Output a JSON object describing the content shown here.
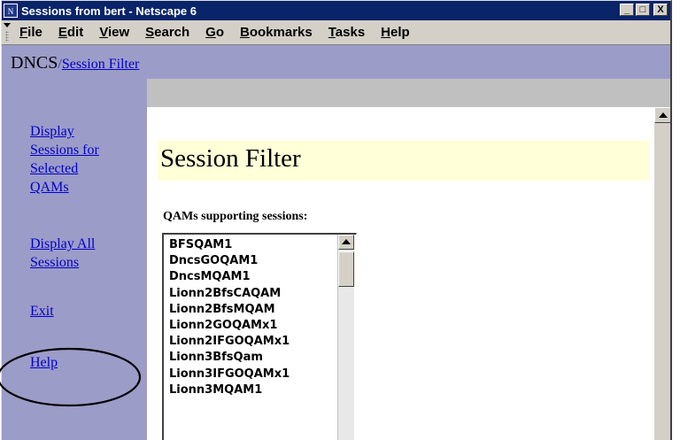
{
  "window": {
    "title": "Sessions from bert - Netscape 6",
    "icon": "N"
  },
  "window_buttons": {
    "minimize": "_",
    "maximize": "□",
    "close": "X"
  },
  "menu": [
    {
      "label": "File",
      "mnemonic": "F",
      "rest": "ile"
    },
    {
      "label": "Edit",
      "mnemonic": "E",
      "rest": "dit"
    },
    {
      "label": "View",
      "mnemonic": "V",
      "rest": "iew"
    },
    {
      "label": "Search",
      "mnemonic": "S",
      "rest": "earch"
    },
    {
      "label": "Go",
      "mnemonic": "G",
      "rest": "o"
    },
    {
      "label": "Bookmarks",
      "mnemonic": "B",
      "rest": "ookmarks"
    },
    {
      "label": "Tasks",
      "mnemonic": "T",
      "rest": "asks"
    },
    {
      "label": "Help",
      "mnemonic": "H",
      "rest": "elp"
    }
  ],
  "breadcrumb": {
    "root": "DNCS",
    "separator": "/",
    "link": "Session Filter"
  },
  "sidebar": {
    "items": [
      {
        "line1": "Display",
        "line2": "Sessions for",
        "line3": "Selected",
        "line4": "QAMs"
      },
      {
        "line1": "Display All",
        "line2": "Sessions"
      },
      {
        "line1": "Exit"
      },
      {
        "line1": "Help"
      }
    ]
  },
  "main": {
    "heading": "Session Filter",
    "list_label": "QAMs supporting sessions:",
    "qams": [
      "BFSQAM1",
      "DncsGOQAM1",
      "DncsMQAM1",
      "Lionn2BfsCAQAM",
      "Lionn2BfsMQAM",
      "Lionn2GOQAMx1",
      "Lionn2IFGOQAMx1",
      "Lionn3BfsQam",
      "Lionn3IFGOQAMx1",
      "Lionn3MQAM1"
    ]
  },
  "colors": {
    "titlebar": "#0a246a",
    "sidebar_bg": "#9c9cc8",
    "heading_bg": "#ffffd8",
    "link": "#0000cc"
  }
}
